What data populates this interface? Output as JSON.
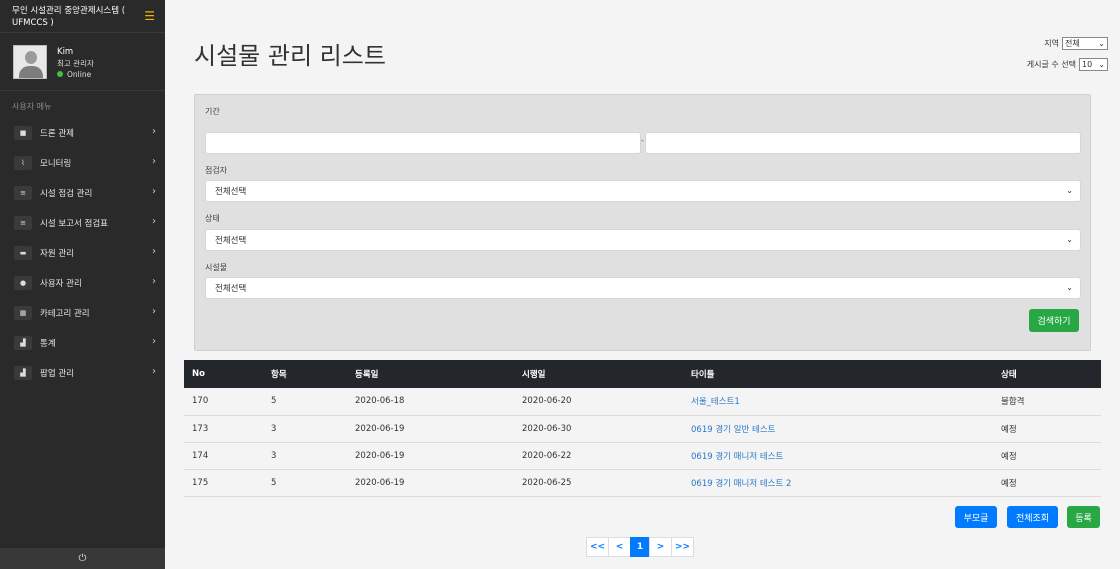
{
  "sidebar": {
    "brand_title": "무인 시설관리 중앙관제시스템 ( UFMCCS )",
    "user": {
      "name": "Kim",
      "role": "최고 관리자",
      "status": "Online"
    },
    "menu_header": "사용자 메뉴",
    "items": [
      {
        "label": "드론 관제",
        "icon": "video-camera-icon"
      },
      {
        "label": "모니터링",
        "icon": "line-chart-icon"
      },
      {
        "label": "시설 점검 관리",
        "icon": "list-icon"
      },
      {
        "label": "시설 보고서 점검표",
        "icon": "list-icon"
      },
      {
        "label": "자원 관리",
        "icon": "hard-drive-icon"
      },
      {
        "label": "사용자 관리",
        "icon": "user-icon"
      },
      {
        "label": "카테고리 관리",
        "icon": "grid-icon"
      },
      {
        "label": "통계",
        "icon": "bar-chart-icon"
      },
      {
        "label": "팝업 관리",
        "icon": "bar-chart-icon"
      }
    ]
  },
  "header": {
    "title": "시설물 관리 리스트",
    "region_label": "지역",
    "region_value": "전체",
    "page_size_label": "게시글 수 선택",
    "page_size_value": "10"
  },
  "filters": {
    "period_label": "기간",
    "period_separator": "-",
    "inspector_label": "점검자",
    "inspector_value": "전체선택",
    "status_label": "상태",
    "status_value": "전체선택",
    "facility_label": "시설물",
    "facility_value": "전체선택",
    "search_label": "검색하기"
  },
  "table": {
    "headers": [
      "No",
      "항목",
      "등록일",
      "시행일",
      "타이틀",
      "상태"
    ],
    "rows": [
      {
        "no": "170",
        "item": "5",
        "registered": "2020-06-18",
        "executed": "2020-06-20",
        "title": "서울_테스트1",
        "status": "불합격"
      },
      {
        "no": "173",
        "item": "3",
        "registered": "2020-06-19",
        "executed": "2020-06-30",
        "title": "0619 경기 일반 테스트",
        "status": "예정"
      },
      {
        "no": "174",
        "item": "3",
        "registered": "2020-06-19",
        "executed": "2020-06-22",
        "title": "0619 경기 매니저 테스트",
        "status": "예정"
      },
      {
        "no": "175",
        "item": "5",
        "registered": "2020-06-19",
        "executed": "2020-06-25",
        "title": "0619 경기 매니저 테스트 2",
        "status": "예정"
      }
    ]
  },
  "actions": {
    "parent_label": "부모글",
    "view_all_label": "전체조회",
    "register_label": "등록"
  },
  "pagination": {
    "first": "<<",
    "prev": "<",
    "current": "1",
    "next": ">",
    "last": ">>"
  },
  "colors": {
    "sidebar_bg": "#2a2a2a",
    "primary": "#007bff",
    "success": "#28a745",
    "table_header": "#23272b",
    "link": "#2878c9"
  }
}
